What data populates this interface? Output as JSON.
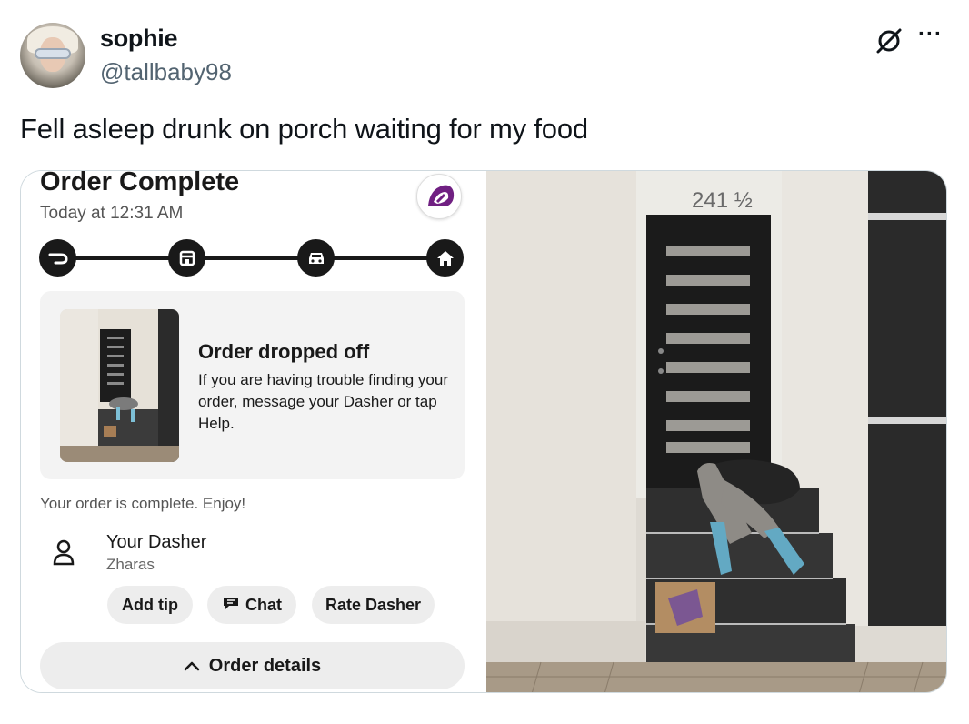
{
  "tweet": {
    "display_name": "sophie",
    "handle": "@tallbaby98",
    "text": "Fell asleep drunk on porch waiting for my food",
    "icons": [
      "grok-icon",
      "more-icon"
    ]
  },
  "app": {
    "title": "Order Complete",
    "time": "Today at 12:31 AM",
    "steps": [
      "dasher-icon",
      "store-icon",
      "car-icon",
      "home-icon"
    ],
    "drop_title": "Order dropped off",
    "drop_body": "If you are having trouble finding your order, message your Dasher or tap Help.",
    "complete_text": "Your order is complete. Enjoy!",
    "dasher_label": "Your Dasher",
    "dasher_name": "Zharas",
    "buttons": {
      "add_tip": "Add tip",
      "chat": "Chat",
      "rate": "Rate Dasher"
    },
    "order_details": "Order details"
  },
  "photo": {
    "address": "241 ½"
  },
  "colors": {
    "text": "#0f1419",
    "muted": "#536471",
    "app_dark": "#191919",
    "brand_purple": "#702082"
  }
}
